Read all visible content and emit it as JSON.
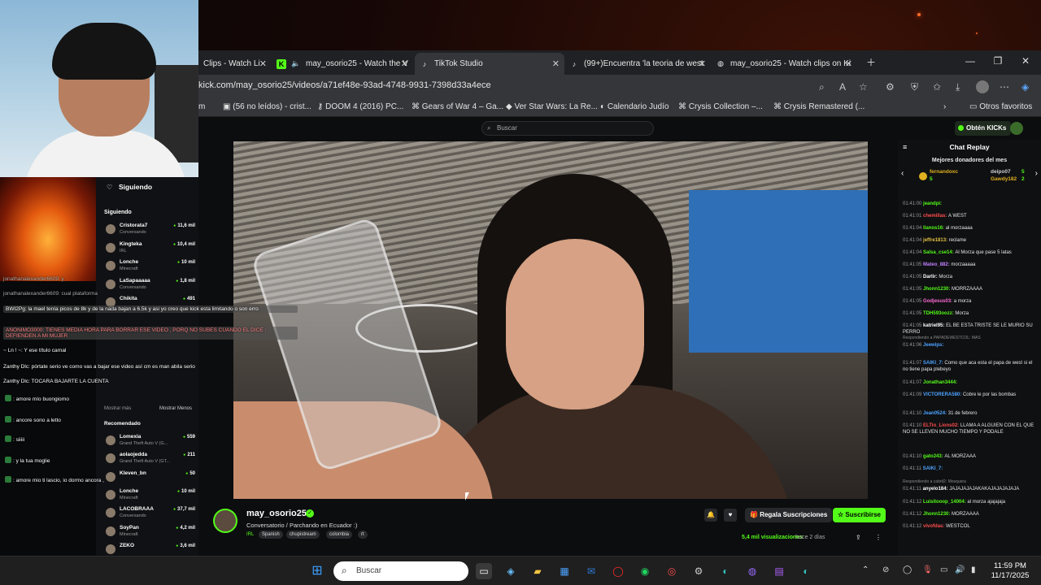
{
  "browser": {
    "tabs": [
      {
        "label": "Clips - Watch Li"
      },
      {
        "label": "may_osorio25 - Watch the V"
      },
      {
        "label": "TikTok Studio"
      },
      {
        "label": "(99+)Encuentra 'la teoria de west"
      },
      {
        "label": "may_osorio25 - Watch clips on Ki"
      }
    ],
    "url": "kick.com/may_osorio25/videos/a71ef48e-93ad-4748-9931-7398d33a4ece",
    "bookmarks": [
      {
        "label": "m"
      },
      {
        "label": "(56 no leídos) - crist..."
      },
      {
        "label": "DOOM 4 (2016) PC..."
      },
      {
        "label": "Gears of War 4 – Ga..."
      },
      {
        "label": "Ver Star Wars: La Re..."
      },
      {
        "label": "Calendario Judío"
      },
      {
        "label": "Crysis Collection –..."
      },
      {
        "label": "Crysis Remastered (..."
      }
    ],
    "other_bookmarks": "Otros favoritos"
  },
  "kick": {
    "search_placeholder": "Buscar",
    "get_kicks": "Obtén KICKs"
  },
  "chat": {
    "title": "Chat Replay",
    "top_donors_title": "Mejores donadores del mes",
    "donors": [
      {
        "name": "fernandoxc",
        "value": "5"
      },
      {
        "name": "deipo07",
        "value": "5"
      },
      {
        "name": "Gawdy182",
        "value": "2"
      }
    ],
    "messages": [
      {
        "time": "01:41:00",
        "user": "jeandpi:",
        "text": "",
        "color": "#53fc18"
      },
      {
        "time": "01:41:01",
        "user": "chemillas:",
        "text": "A WEST",
        "color": "#ff4d4d"
      },
      {
        "time": "01:41:04",
        "user": "llanos16:",
        "text": "al morzaaaa",
        "color": "#53fc18"
      },
      {
        "time": "01:41:04",
        "user": "jeffre1813:",
        "text": "reclame",
        "color": "#e0c040"
      },
      {
        "time": "01:41:04",
        "user": "Salsa_cse14:",
        "text": "Al Morza que pase 5 latas",
        "color": "#53fc18"
      },
      {
        "time": "01:41:05",
        "user": "Mateo_882:",
        "text": "morzaaaaa",
        "color": "#c080ff"
      },
      {
        "time": "01:41:05",
        "user": "Darlir:",
        "text": "Morza",
        "color": "#ffffff"
      },
      {
        "time": "01:41:05",
        "user": "Jhonn1230:",
        "text": "MORRZAAAA",
        "color": "#53fc18"
      },
      {
        "time": "01:41:05",
        "user": "Godjesus03:",
        "text": "a morza",
        "color": "#ff6bd6"
      },
      {
        "time": "01:41:05",
        "user": "TDH593oozz:",
        "text": "Morza",
        "color": "#53fc18"
      },
      {
        "time": "01:41:05",
        "user": "katriel95:",
        "text": "EL BE ESTA TRISTE SE LE MURIO SU PERRO",
        "color": "#ffffff"
      },
      {
        "time": "01:41:06",
        "user": "Jeewips:",
        "text": "",
        "color": "#4da3ff"
      },
      {
        "time": "01:41:07",
        "user": "SAIKI_7:",
        "text": "Como que aca esta el papa de west si el no tiene papa plebeyo",
        "color": "#4da3ff"
      },
      {
        "time": "01:41:07",
        "user": "Jonathan3444:",
        "text": "",
        "color": "#53fc18"
      },
      {
        "time": "01:41:09",
        "user": "VICTORERA580:",
        "text": "Cobre le por las bombas",
        "color": "#4da3ff"
      },
      {
        "time": "01:41:10",
        "user": "Jean0524:",
        "text": "31 de febrero",
        "color": "#4da3ff"
      },
      {
        "time": "01:41:10",
        "user": "ELTio_Lions02:",
        "text": "LLAMA A ALGUIEN CON EL QUE NO SE LLEVEN MUCHO TIEMPO Y PODALE",
        "color": "#ff4d4d"
      },
      {
        "time": "01:41:10",
        "user": "gato243:",
        "text": "AL MORZAAA",
        "color": "#53fc18"
      },
      {
        "time": "01:41:11",
        "user": "SAIKI_7:",
        "text": "",
        "color": "#4da3ff"
      },
      {
        "time": "01:41:11",
        "user": "anyelo184:",
        "text": "JAJAJAJAJAKAKAJAJAJAJAJA",
        "color": "#ffffff"
      },
      {
        "time": "01:41:12",
        "user": "Luisitooop_14004:",
        "text": "al morza ajajajaja",
        "color": "#53fc18"
      },
      {
        "time": "01:41:12",
        "user": "Jhonn1230:",
        "text": "MORZAAAA",
        "color": "#53fc18"
      },
      {
        "time": "01:41:12",
        "user": "vivofdas:",
        "text": "WESTCOL",
        "color": "#ff4d4d"
      }
    ],
    "reply_note_1": "Respondiendo a PAPADEWESTCOL: MAS",
    "reply_note_2": "Respondiendo a cabrit2: Mosquera"
  },
  "video_info": {
    "channel": "may_osorio25",
    "title": "Conversatorio / Parchando en Ecuador :)",
    "tags": [
      "IRL",
      "Spanish",
      "chupistream",
      "colombia",
      "rt"
    ],
    "gift_label": "Regala Suscripciones",
    "subscribe_label": "Suscribirse",
    "views": "5,4 mil visualizaciones",
    "ago": "hace 2 días"
  },
  "sidebar": {
    "heading": "Siguiendo",
    "section": "Siguiendo",
    "following": [
      {
        "name": "Cristorata7",
        "sub": "Conversando",
        "viewers": "11,6 mil"
      },
      {
        "name": "Kingteka",
        "sub": "IRL",
        "viewers": "10,4 mil"
      },
      {
        "name": "Lonche",
        "sub": "Minecraft",
        "viewers": "10 mil"
      },
      {
        "name": "LaSapaaaaa",
        "sub": "Conversando",
        "viewers": "1,8 mil"
      },
      {
        "name": "Chikita",
        "sub": "",
        "viewers": "491"
      }
    ],
    "show_more": "Mostrar más",
    "show_less": "Mostrar Menos",
    "recommended": "Recomendado",
    "recs": [
      {
        "name": "Lomexia",
        "sub": "Grand Theft Auto V (G...",
        "viewers": "559"
      },
      {
        "name": "aolaojedda",
        "sub": "Grand Theft Auto V (GT...",
        "viewers": "211"
      },
      {
        "name": "Kleven_bn",
        "sub": "",
        "viewers": "50"
      },
      {
        "name": "Lonche",
        "sub": "Minecraft",
        "viewers": "10 mil"
      },
      {
        "name": "LACOBRAAA",
        "sub": "Conversando",
        "viewers": "37,7 mil"
      },
      {
        "name": "SoyPan",
        "sub": "Minecraft",
        "viewers": "4,2 mil"
      },
      {
        "name": "ZEKO",
        "sub": "",
        "viewers": "3,6 mil"
      }
    ]
  },
  "overlay_chat": [
    {
      "text": "jonathanalexander6609: y"
    },
    {
      "text": "jonathanalexander6609: cual plataforma"
    },
    {
      "text": "BWI2Pg: la mael tenía picos de 8k y de la nada bajan a 6.5k y asi yo creo que kick esta limitando o son erro"
    },
    {
      "text": "ANONIMO3000: TIENES MEDIA HORA PARA BORRAR ESE VIDEO , PORQ NO SUBES CUANDO EL DICE : DEFIENDEN A MI MUJER"
    },
    {
      "text": "~ Ln ! ~: Y ese título carnal"
    },
    {
      "text": "Zanthy Dlc: pórtate serio ve como vas a bajar ese video así cm es man abila serio"
    },
    {
      "text": "Zanthy Dlc: TOCARA BAJARTE LA CUENTA"
    },
    {
      "text": ": amore mío buongiorno"
    },
    {
      "text": ": ancore sono a letto"
    },
    {
      "text": ": siiiii"
    },
    {
      "text": ": y la tua moglie"
    },
    {
      "text": ": amore mio ti lascio, io dormo ancora ,"
    }
  ],
  "taskbar": {
    "search_placeholder": "Buscar",
    "time": "11:59 PM",
    "date": "11/17/2025"
  },
  "colors": {
    "kick_green": "#53fc18",
    "page_bg": "#0c0d0f",
    "tab_bg": "#202124"
  }
}
